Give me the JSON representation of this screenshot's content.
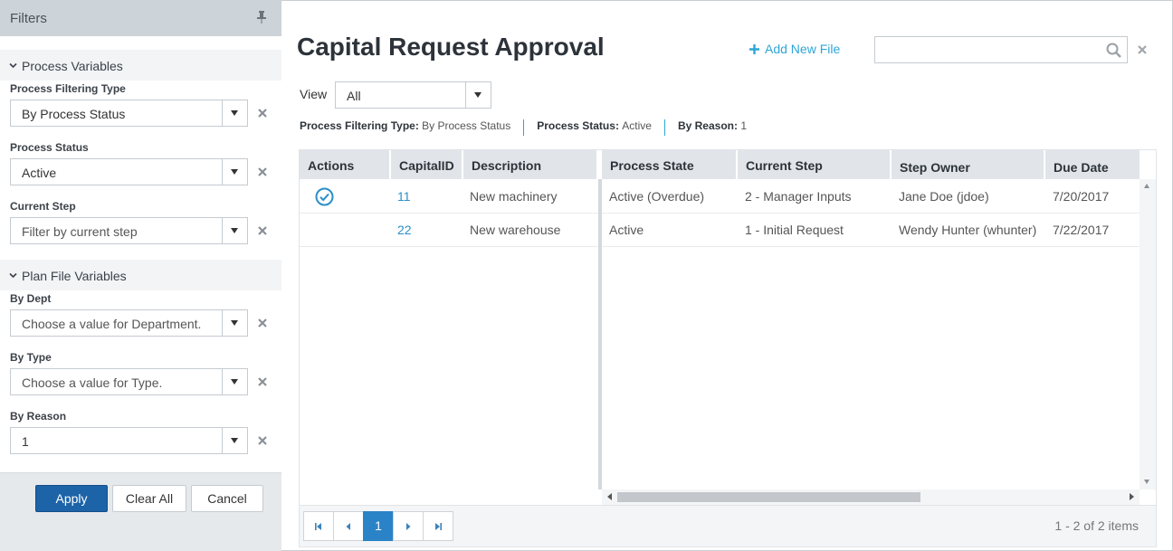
{
  "filters": {
    "title": "Filters",
    "sections": {
      "process_variables": "Process Variables",
      "plan_file_variables": "Plan File Variables"
    },
    "fields": [
      {
        "label": "Process Filtering Type",
        "value": "By Process Status"
      },
      {
        "label": "Process Status",
        "value": "Active"
      },
      {
        "label": "Current Step",
        "placeholder": "Filter by current step"
      },
      {
        "label": "By Dept",
        "placeholder": "Choose a value for Department."
      },
      {
        "label": "By Type",
        "placeholder": "Choose a value for Type."
      },
      {
        "label": "By Reason",
        "value": "1"
      }
    ],
    "buttons": {
      "apply": "Apply",
      "clear_all": "Clear All",
      "cancel": "Cancel"
    }
  },
  "main": {
    "title": "Capital Request Approval",
    "add_new_file": "Add New File",
    "search": {
      "placeholder": ""
    },
    "view": {
      "label": "View",
      "value": "All"
    },
    "applied_filters": [
      {
        "name": "Process Filtering Type",
        "value": "By Process Status"
      },
      {
        "name": "Process Status",
        "value": "Active"
      },
      {
        "name": "By Reason",
        "value": "1"
      }
    ],
    "grid": {
      "columns": [
        "Actions",
        "CapitalID",
        "Description",
        "Process State",
        "Current Step",
        "Step Owner",
        "Due Date"
      ],
      "rows": [
        {
          "action_icon": "check-circle-icon",
          "capital_id": "11",
          "description": "New machinery",
          "process_state": "Active (Overdue)",
          "current_step": "2 - Manager Inputs",
          "step_owner": "Jane Doe (jdoe)",
          "due_date": "7/20/2017"
        },
        {
          "action_icon": "",
          "capital_id": "22",
          "description": "New warehouse",
          "process_state": "Active",
          "current_step": "1 - Initial Request",
          "step_owner": "Wendy Hunter (whunter)",
          "due_date": "7/22/2017"
        }
      ]
    },
    "pager": {
      "current_page": "1",
      "info": "1 - 2 of 2 items"
    }
  },
  "colors": {
    "accent": "#2ea6d6",
    "primary_button": "#1d63a8",
    "page_current": "#2a83c6",
    "filters_header": "#ccd3d9"
  }
}
